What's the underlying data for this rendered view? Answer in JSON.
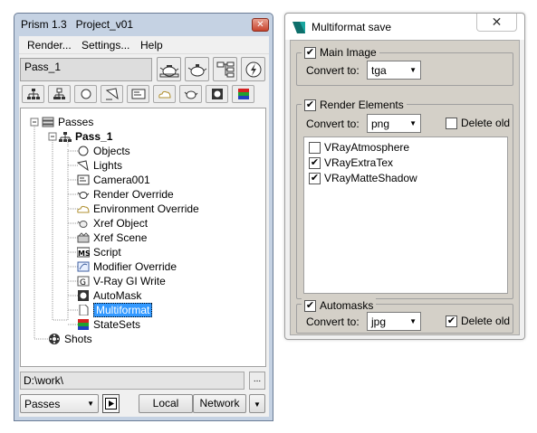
{
  "prism": {
    "title": "Prism 1.3   Project_v01",
    "close": "✕",
    "menu": [
      "Render...",
      "Settings...",
      "Help"
    ],
    "pass_name": "Pass_1",
    "tree": {
      "root": "Passes",
      "pass": "Pass_1",
      "items": [
        "Objects",
        "Lights",
        "Camera001",
        "Render Override",
        "Environment Override",
        "Xref Object",
        "Xref Scene",
        "Script",
        "Modifier Override",
        "V-Ray GI Write",
        "AutoMask",
        "Multiformat",
        "StateSets"
      ],
      "shots": "Shots"
    },
    "path": "D:\\work\\",
    "dots": "...",
    "mode_select": "Passes",
    "local_label": "Local",
    "network_label": "Network"
  },
  "multiformat": {
    "title": "Multiformat save",
    "close": "✕",
    "main_image": {
      "label": "Main Image",
      "checked": true,
      "convert_label": "Convert to:",
      "format": "tga"
    },
    "render_elements": {
      "label": "Render Elements",
      "checked": true,
      "convert_label": "Convert to:",
      "format": "png",
      "delete_old_label": "Delete old",
      "delete_old": false,
      "elements": [
        {
          "name": "VRayAtmosphere",
          "checked": false
        },
        {
          "name": "VRayExtraTex",
          "checked": true
        },
        {
          "name": "VRayMatteShadow",
          "checked": true
        }
      ]
    },
    "automasks": {
      "label": "Automasks",
      "checked": true,
      "convert_label": "Convert to:",
      "format": "jpg",
      "delete_old_label": "Delete old",
      "delete_old": true
    }
  }
}
